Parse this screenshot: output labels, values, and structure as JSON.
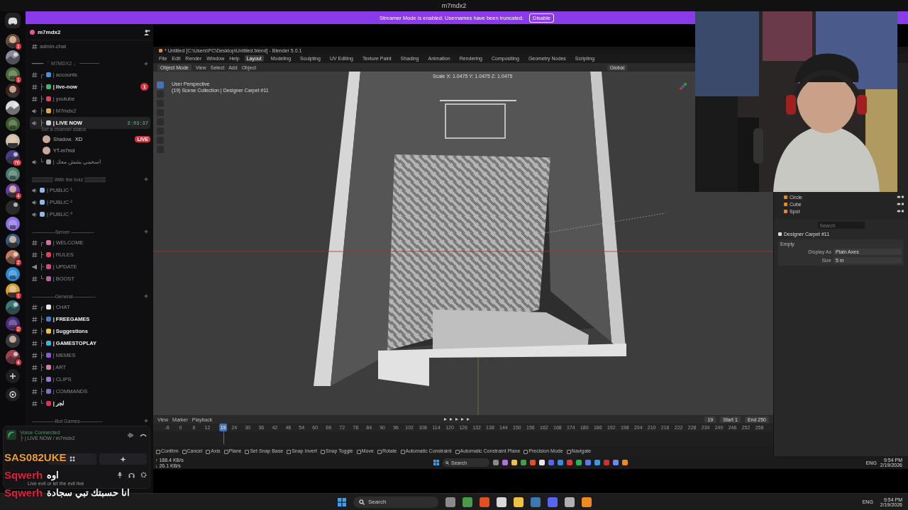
{
  "window": {
    "title": "m7mdx2"
  },
  "banner": {
    "message": "Streamer Mode is enabled. Usernames have been truncated.",
    "button": "Disable"
  },
  "servers": [
    {
      "kind": "picture",
      "badge": "1"
    },
    {
      "kind": "picture"
    },
    {
      "kind": "picture",
      "badge": "1"
    },
    {
      "kind": "picture"
    },
    {
      "kind": "picture"
    },
    {
      "kind": "picture"
    },
    {
      "kind": "picture"
    },
    {
      "kind": "picture",
      "badge": "76"
    },
    {
      "kind": "picture"
    },
    {
      "kind": "picture",
      "badge": "4"
    },
    {
      "kind": "picture"
    },
    {
      "kind": "picture"
    },
    {
      "kind": "picture"
    },
    {
      "kind": "picture",
      "badge": "2"
    },
    {
      "kind": "picture"
    },
    {
      "kind": "picture",
      "badge": "1"
    },
    {
      "kind": "picture"
    },
    {
      "kind": "picture",
      "badge": "2"
    },
    {
      "kind": "picture"
    },
    {
      "kind": "picture",
      "badge": "4"
    }
  ],
  "server": {
    "name": "m7mdx2"
  },
  "channels": [
    {
      "kind": "text",
      "label": "admin-chat",
      "unread": false,
      "selected": false
    },
    {
      "kind": "category",
      "label": "━━━━ 「 M7MDX2 」 ━━━━"
    },
    {
      "kind": "text",
      "tree": "┌",
      "color": "#4a90d9",
      "label": "| accounts",
      "unread": false,
      "selected": false
    },
    {
      "kind": "text",
      "tree": "├",
      "color": "#2fbf5f",
      "label": "| live-now",
      "unread": true,
      "badge": "1",
      "selected": false
    },
    {
      "kind": "text",
      "tree": "├",
      "color": "#e0425a",
      "label": "| youtube",
      "unread": false,
      "selected": false
    },
    {
      "kind": "voice",
      "tree": "├",
      "color": "#e8a33a",
      "label": "| M7mdx2",
      "unread": false,
      "selected": false
    },
    {
      "kind": "voice",
      "tree": "├",
      "color": "#cfcfcf",
      "label": "| LIVE NOW",
      "unread": true,
      "selected": true,
      "time": "2:03:37",
      "status": "Set a channel status",
      "members": [
        {
          "name": "Shadow.",
          "tag": "XD",
          "badge": "LIVE"
        },
        {
          "name": "YT-m7md"
        }
      ]
    },
    {
      "kind": "voice",
      "tree": "└",
      "color": "#9a9a9a",
      "label": "| اسحبني بشش معك",
      "unread": false,
      "selected": false
    },
    {
      "kind": "category",
      "label": "▒▒▒▒▒▒ With the boiz ▒▒▒▒▒▒"
    },
    {
      "kind": "voice",
      "color": "#8fb8e8",
      "label": "| PUBLIC ¹",
      "unread": false,
      "selected": false
    },
    {
      "kind": "voice",
      "color": "#8fb8e8",
      "label": "| PUBLIC ²",
      "unread": false,
      "selected": false
    },
    {
      "kind": "voice",
      "color": "#8fb8e8",
      "label": "| PUBLIC ³",
      "unread": false,
      "selected": false
    },
    {
      "kind": "category",
      "label": "--————Server ————--"
    },
    {
      "kind": "text",
      "tree": "┌",
      "color": "#e06aa0",
      "label": "| WELCOME",
      "unread": false,
      "selected": false
    },
    {
      "kind": "text",
      "tree": "├",
      "color": "#e0425a",
      "label": "| RULES",
      "unread": false,
      "selected": false
    },
    {
      "kind": "announcement",
      "tree": "├",
      "color": "#e0427a",
      "label": "| UPDATE",
      "unread": false,
      "selected": false
    },
    {
      "kind": "text",
      "tree": "└",
      "color": "#b06a9a",
      "label": "| BOOST",
      "unread": false,
      "selected": false
    },
    {
      "kind": "category",
      "label": "--————General————--"
    },
    {
      "kind": "text",
      "tree": "┌",
      "color": "#e8e8e8",
      "label": "| CHAT",
      "unread": false,
      "selected": false
    },
    {
      "kind": "text",
      "tree": "├",
      "color": "#3b7fd9",
      "label": "| FREEGAMES",
      "unread": true,
      "selected": false
    },
    {
      "kind": "text",
      "tree": "├",
      "color": "#f0c040",
      "label": "| Suggestions",
      "unread": true,
      "selected": false
    },
    {
      "kind": "text",
      "tree": "├",
      "color": "#38b8e0",
      "label": "| GAMESTOPLAY",
      "unread": true,
      "selected": false
    },
    {
      "kind": "text",
      "tree": "├",
      "color": "#8a5ad0",
      "label": "| MEMES",
      "unread": false,
      "selected": false
    },
    {
      "kind": "text",
      "tree": "├",
      "color": "#e07aa0",
      "label": "| ART",
      "unread": false,
      "selected": false
    },
    {
      "kind": "text",
      "tree": "├",
      "color": "#9a7ad0",
      "label": "| CLIPS",
      "unread": false,
      "selected": false
    },
    {
      "kind": "text",
      "tree": "├",
      "color": "#8a6ac0",
      "label": "| COMMANDS",
      "unread": false,
      "selected": false
    },
    {
      "kind": "text",
      "tree": "└",
      "color": "#e0305a",
      "label": "| لجر",
      "unread": true,
      "selected": false
    },
    {
      "kind": "category",
      "label": "--————Bot Games————--"
    }
  ],
  "voice_panel": {
    "title": "Voice Connected",
    "subtitle": "├ | LIVE NOW / m7mdx2",
    "user_status": "Live evil or let the evil live"
  },
  "chat_overlay": [
    {
      "user": "SAS082UKE",
      "color": "#f0a020"
    },
    {
      "user": "Sqwerh",
      "color": "#e0203c",
      "text": "اوه"
    },
    {
      "user": "Sqwerh",
      "color": "#e0203c",
      "text": "انا حسبتك تبي سجادة"
    }
  ],
  "blender": {
    "title": "* Untitled [C:\\Users\\PC\\Desktop\\Untitled.blend] - Blender 5.0.1",
    "menus": [
      "File",
      "Edit",
      "Render",
      "Window",
      "Help"
    ],
    "workspaces": [
      {
        "label": "Layout",
        "selected": true
      },
      {
        "label": "Modeling",
        "selected": false
      },
      {
        "label": "Sculpting",
        "selected": false
      },
      {
        "label": "UV Editing",
        "selected": false
      },
      {
        "label": "Texture Paint",
        "selected": false
      },
      {
        "label": "Shading",
        "selected": false
      },
      {
        "label": "Animation",
        "selected": false
      },
      {
        "label": "Rendering",
        "selected": false
      },
      {
        "label": "Compositing",
        "selected": false
      },
      {
        "label": "Geometry Nodes",
        "selected": false
      },
      {
        "label": "Scripting",
        "selected": false
      }
    ],
    "mode": "Object Mode",
    "header_menus": [
      "View",
      "Select",
      "Add",
      "Object"
    ],
    "orientation": "Global",
    "viewport_info": [
      "User Perspective",
      "(19) Scene Collection | Designer Carpet #11"
    ],
    "transform_info": "Scale X: 1.0475  Y: 1.0475  Z: 1.0475",
    "timeline": {
      "menus": [
        "View",
        "Marker",
        "Playback"
      ],
      "current_frame": "19",
      "level": 0.0947,
      "frame_field": "19",
      "start_label": "Start",
      "start": "1",
      "end_label": "End",
      "end": "250",
      "ticks": [
        "-6",
        "0",
        "6",
        "12",
        "24",
        "30",
        "36",
        "42",
        "48",
        "54",
        "60",
        "66",
        "72",
        "78",
        "84",
        "90",
        "96",
        "102",
        "108",
        "114",
        "120",
        "126",
        "132",
        "138",
        "144",
        "150",
        "156",
        "162",
        "168",
        "174",
        "180",
        "186",
        "192",
        "198",
        "204",
        "210",
        "216",
        "222",
        "228",
        "234",
        "240",
        "246",
        "252",
        "258"
      ]
    },
    "status_hints": [
      "Confirm",
      "Cancel",
      "Axis",
      "Plane",
      "Set Snap Base",
      "Snap Invert",
      "Snap Toggle",
      "Move",
      "Rotate",
      "Automatic Constraint",
      "Automatic Constraint Plane",
      "Precision Mode",
      "Navigate"
    ],
    "outliner": [
      "Circle",
      "Cube",
      "Spot"
    ],
    "properties": {
      "search_placeholder": "Search",
      "object": "Designer Carpet #11",
      "panel": "Empty",
      "fields": [
        {
          "label": "Display As",
          "value": "Plain Axes"
        },
        {
          "label": "Size",
          "value": "5 m"
        }
      ]
    },
    "net_speed": [
      "↑ 188.4 KB/s",
      "↓ 26.1 KB/s"
    ]
  },
  "stream_taskbar": {
    "search": "Search",
    "apps": [
      {
        "color": "#8a8a8a"
      },
      {
        "color": "#b070e0"
      },
      {
        "color": "#f0c040"
      },
      {
        "color": "#4a9a4a"
      },
      {
        "color": "#e05020"
      },
      {
        "color": "#e8e8e8"
      },
      {
        "color": "#5865f2"
      },
      {
        "color": "#3a8ae0"
      },
      {
        "color": "#e03a3a"
      },
      {
        "color": "#1db954"
      },
      {
        "color": "#5a7af0"
      },
      {
        "color": "#3a9ae0"
      },
      {
        "color": "#d03030"
      },
      {
        "color": "#6a8af0"
      },
      {
        "color": "#f08a20"
      }
    ],
    "language": "ENG",
    "time": "9:54 PM",
    "date": "2/19/2026"
  },
  "taskbar": {
    "search": "Search",
    "apps": [
      {
        "color": "#8a8a8a"
      },
      {
        "color": "#4a9a4a"
      },
      {
        "color": "#e05020"
      },
      {
        "color": "#d8d8d8"
      },
      {
        "color": "#f0c040"
      },
      {
        "color": "#3a7ab0"
      },
      {
        "color": "#5865f2"
      },
      {
        "color": "#b0b0b0"
      },
      {
        "color": "#f08a20"
      }
    ],
    "language": "ENG",
    "time": "9:54 PM",
    "date": "2/19/2026"
  }
}
